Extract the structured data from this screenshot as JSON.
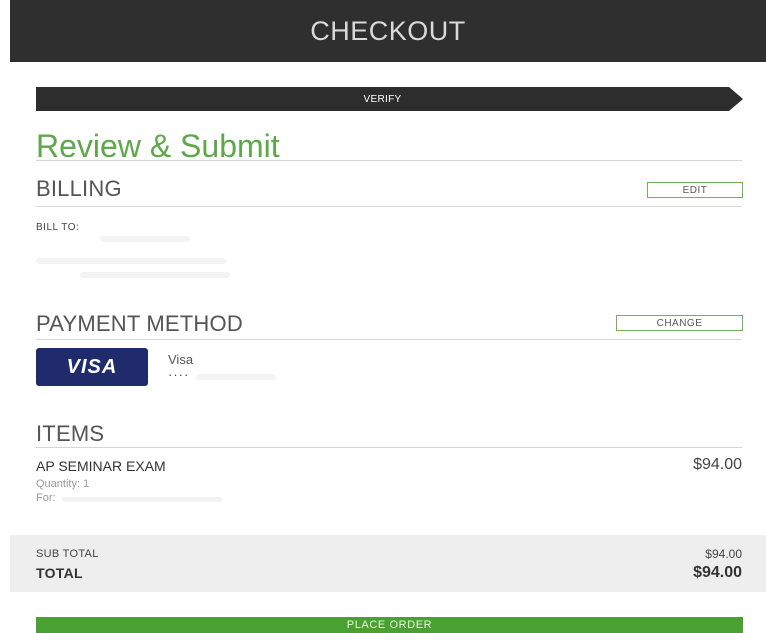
{
  "header": {
    "title": "CHECKOUT"
  },
  "steps": {
    "current": "VERIFY"
  },
  "page": {
    "title": "Review & Submit"
  },
  "billing": {
    "title": "BILLING",
    "edit_label": "EDIT",
    "bill_to_label": "BILL TO:"
  },
  "payment": {
    "title": "PAYMENT METHOD",
    "change_label": "CHANGE",
    "card_logo": "VISA",
    "card_name": "Visa",
    "card_mask": "····"
  },
  "items": {
    "title": "ITEMS",
    "list": [
      {
        "name": "AP SEMINAR EXAM",
        "price": "$94.00",
        "quantity": "Quantity: 1",
        "for": "For:"
      }
    ]
  },
  "totals": {
    "subtotal_label": "SUB TOTAL",
    "subtotal_value": "$94.00",
    "total_label": "TOTAL",
    "total_value": "$94.00"
  },
  "actions": {
    "place_order_label": "PLACE ORDER"
  },
  "colors": {
    "accent": "#5ea84a",
    "header_bg": "#2f2f2f",
    "visa_blue": "#1f2b6b",
    "button_green": "#4aa033"
  }
}
